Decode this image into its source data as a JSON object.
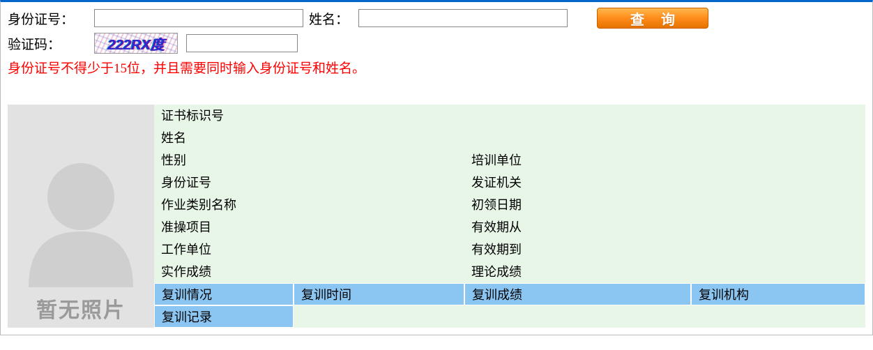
{
  "form": {
    "id_label": "身份证号：",
    "id_value": "",
    "name_label": "姓名：",
    "name_value": "",
    "query_label": "查询",
    "captcha_label": "验证码：",
    "captcha_text": "222RX度",
    "captcha_value": ""
  },
  "error_message": "身份证号不得少于15位，并且需要同时输入身份证号和姓名。",
  "detail": {
    "photo_placeholder": "暂无照片",
    "labels": {
      "cert_id": "证书标识号",
      "name": "姓名",
      "gender": "性别",
      "train_unit": "培训单位",
      "id_no": "身份证号",
      "issue_auth": "发证机关",
      "job_cat": "作业类别名称",
      "first_date": "初领日期",
      "permit_item": "准操项目",
      "valid_from": "有效期从",
      "work_unit": "工作单位",
      "valid_to": "有效期到",
      "practical_score": "实作成绩",
      "theory_score": "理论成绩",
      "retrain_status": "复训情况",
      "retrain_time": "复训时间",
      "retrain_score": "复训成绩",
      "retrain_org": "复训机构",
      "retrain_record": "复训记录"
    }
  }
}
